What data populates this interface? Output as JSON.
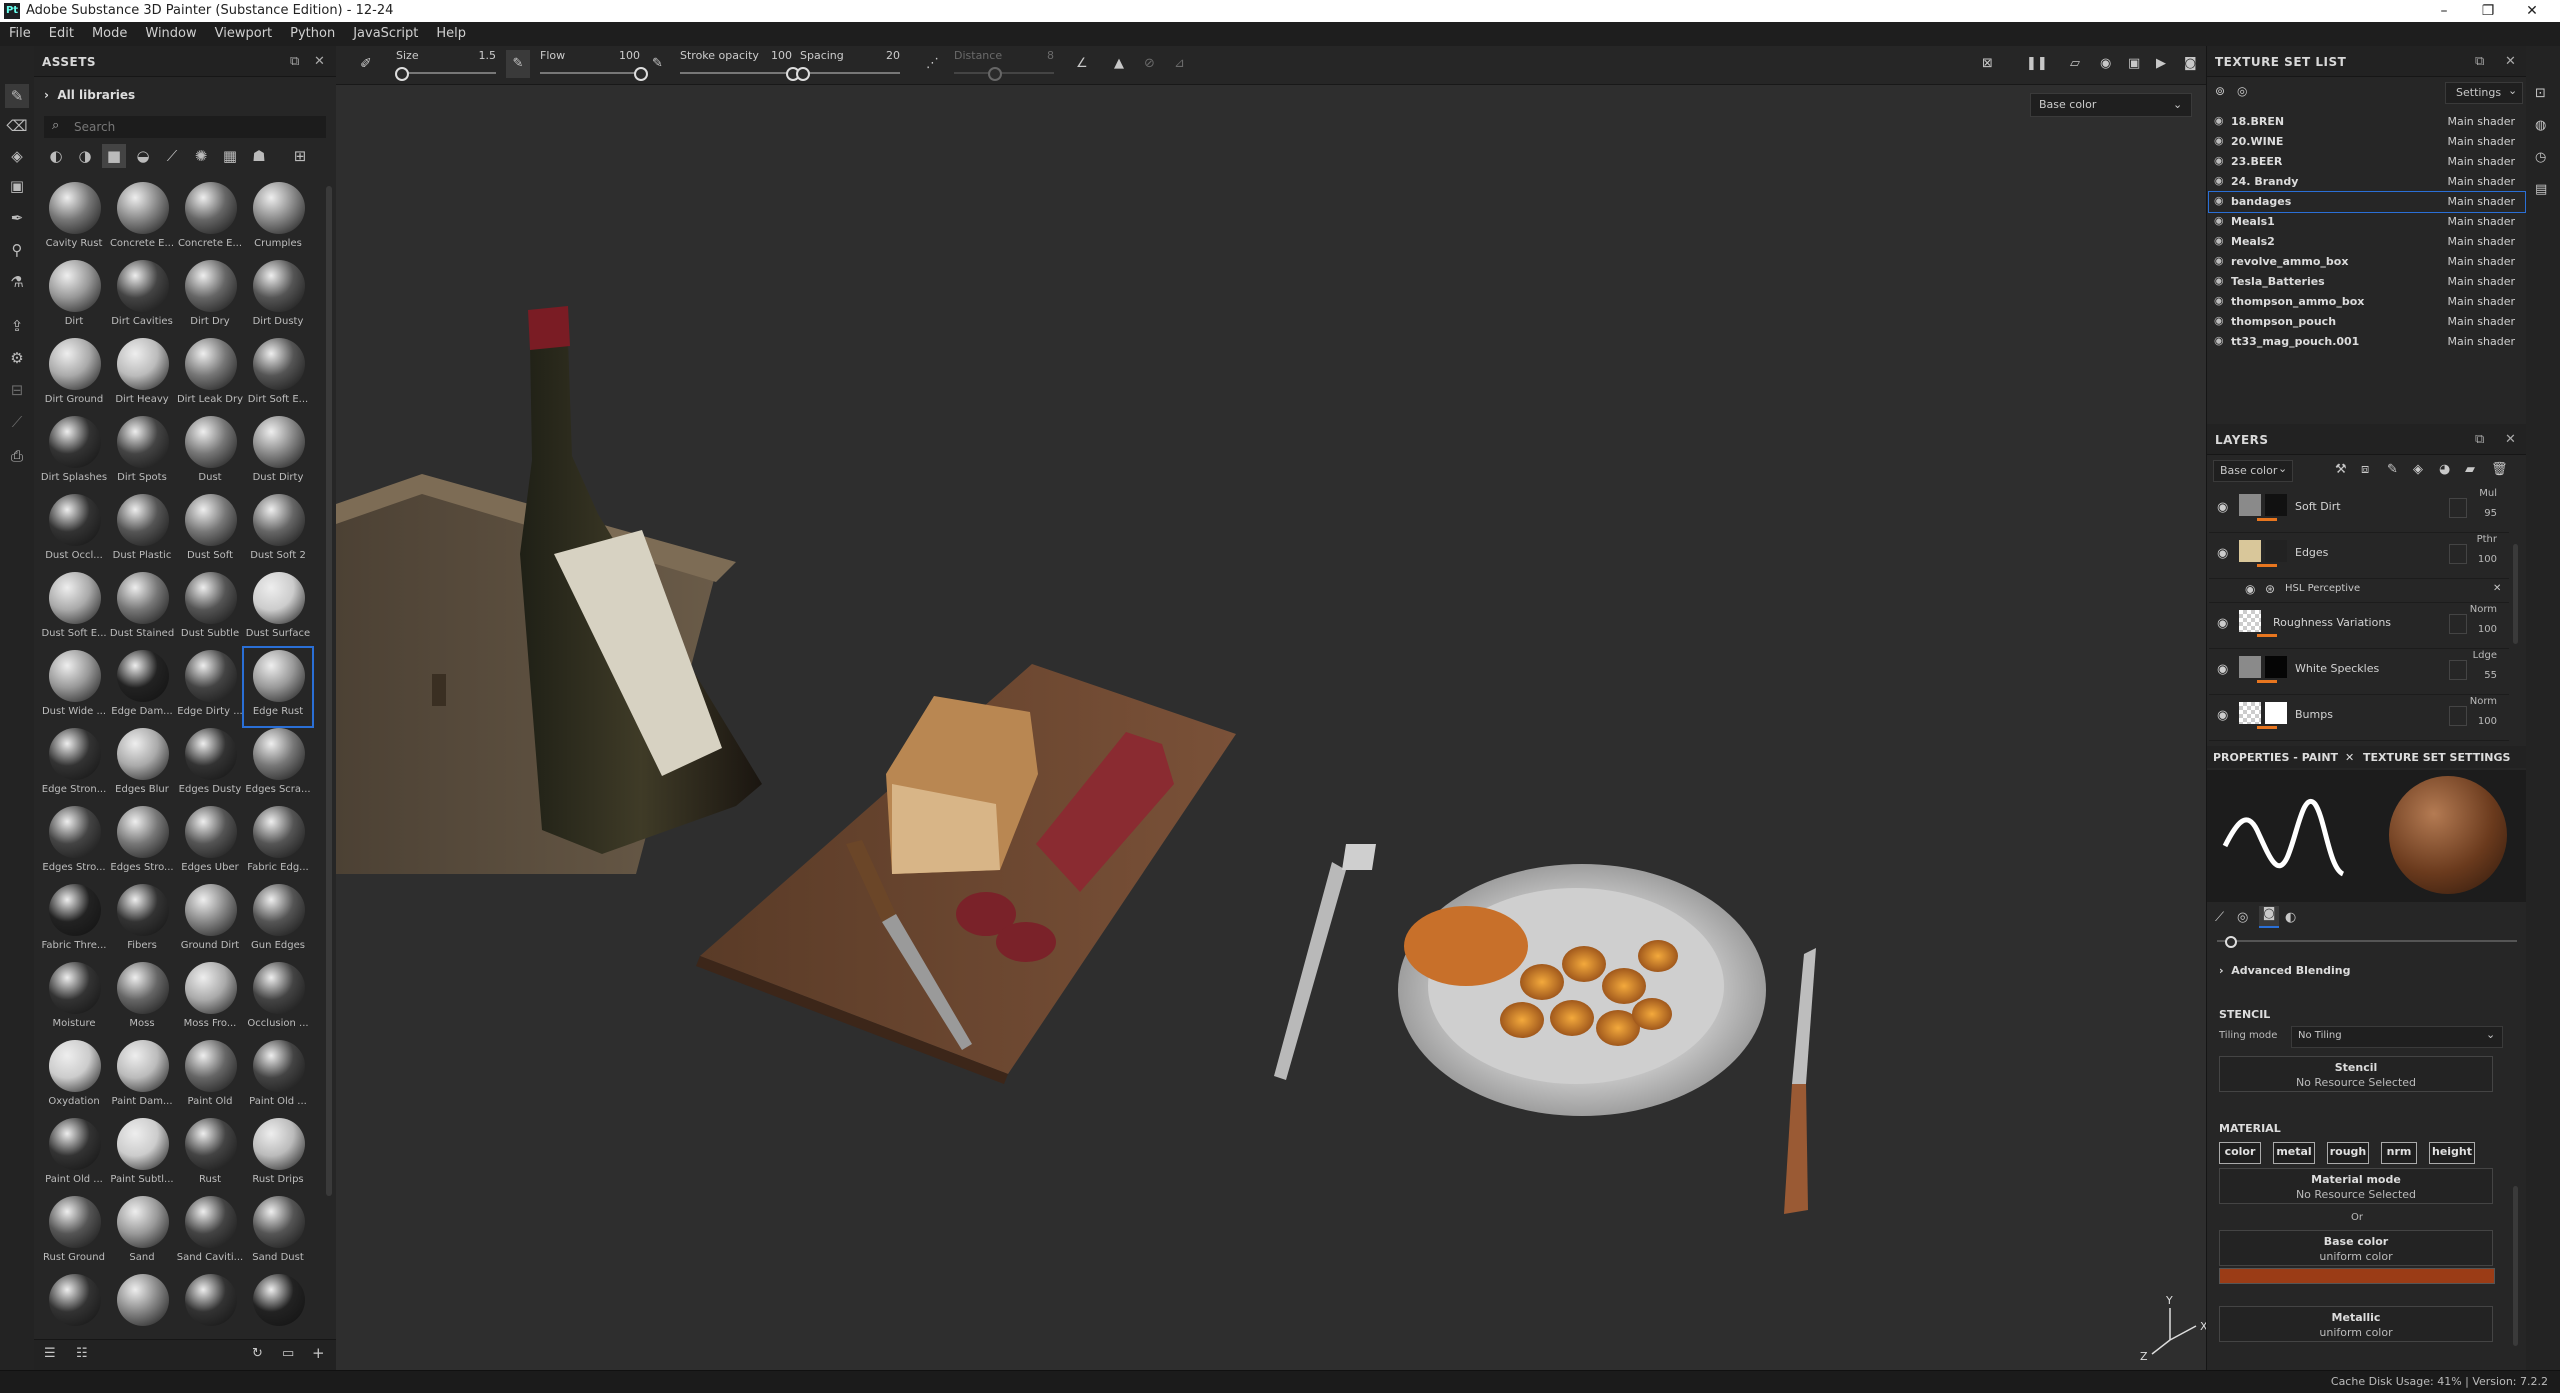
{
  "window": {
    "title": "Adobe Substance 3D Painter (Substance Edition) - 12-24",
    "logo": "Pt",
    "controls": [
      "–",
      "❐",
      "✕"
    ]
  },
  "menu": [
    "File",
    "Edit",
    "Mode",
    "Window",
    "Viewport",
    "Python",
    "JavaScript",
    "Help"
  ],
  "assets": {
    "title": "ASSETS",
    "library": "All libraries",
    "search_placeholder": "Search",
    "items": [
      {
        "label": "Cavity Rust",
        "tone": "#777"
      },
      {
        "label": "Concrete E...",
        "tone": "#888"
      },
      {
        "label": "Concrete E...",
        "tone": "#666"
      },
      {
        "label": "Crumples",
        "tone": "#8a8a8a"
      },
      {
        "label": "Dirt",
        "tone": "#999"
      },
      {
        "label": "Dirt Cavities",
        "tone": "#444"
      },
      {
        "label": "Dirt Dry",
        "tone": "#666"
      },
      {
        "label": "Dirt Dusty",
        "tone": "#555"
      },
      {
        "label": "Dirt Ground",
        "tone": "#aaa"
      },
      {
        "label": "Dirt Heavy",
        "tone": "#bbb"
      },
      {
        "label": "Dirt Leak Dry",
        "tone": "#777"
      },
      {
        "label": "Dirt Soft E...",
        "tone": "#555"
      },
      {
        "label": "Dirt Splashes",
        "tone": "#333"
      },
      {
        "label": "Dirt Spots",
        "tone": "#444"
      },
      {
        "label": "Dust",
        "tone": "#777"
      },
      {
        "label": "Dust Dirty",
        "tone": "#888"
      },
      {
        "label": "Dust Occl...",
        "tone": "#333"
      },
      {
        "label": "Dust Plastic",
        "tone": "#555"
      },
      {
        "label": "Dust Soft",
        "tone": "#777"
      },
      {
        "label": "Dust Soft 2",
        "tone": "#666"
      },
      {
        "label": "Dust Soft E...",
        "tone": "#aaa"
      },
      {
        "label": "Dust Stained",
        "tone": "#777"
      },
      {
        "label": "Dust Subtle",
        "tone": "#555"
      },
      {
        "label": "Dust Surface",
        "tone": "#ccc"
      },
      {
        "label": "Dust Wide ...",
        "tone": "#999"
      },
      {
        "label": "Edge Dam...",
        "tone": "#222"
      },
      {
        "label": "Edge Dirty ...",
        "tone": "#444"
      },
      {
        "label": "Edge Rust",
        "tone": "#999"
      },
      {
        "label": "Edge Stron...",
        "tone": "#333"
      },
      {
        "label": "Edges Blur",
        "tone": "#aaa"
      },
      {
        "label": "Edges Dusty",
        "tone": "#333"
      },
      {
        "label": "Edges Scra...",
        "tone": "#777"
      },
      {
        "label": "Edges Stro...",
        "tone": "#444"
      },
      {
        "label": "Edges Stro...",
        "tone": "#777"
      },
      {
        "label": "Edges Uber",
        "tone": "#555"
      },
      {
        "label": "Fabric Edg...",
        "tone": "#555"
      },
      {
        "label": "Fabric Thre...",
        "tone": "#222"
      },
      {
        "label": "Fibers",
        "tone": "#333"
      },
      {
        "label": "Ground Dirt",
        "tone": "#888"
      },
      {
        "label": "Gun Edges",
        "tone": "#555"
      },
      {
        "label": "Moisture",
        "tone": "#333"
      },
      {
        "label": "Moss",
        "tone": "#666"
      },
      {
        "label": "Moss Fro...",
        "tone": "#aaa"
      },
      {
        "label": "Occlusion ...",
        "tone": "#444"
      },
      {
        "label": "Oxydation",
        "tone": "#ccc"
      },
      {
        "label": "Paint Dam...",
        "tone": "#bbb"
      },
      {
        "label": "Paint Old",
        "tone": "#666"
      },
      {
        "label": "Paint Old ...",
        "tone": "#444"
      },
      {
        "label": "Paint Old ...",
        "tone": "#333"
      },
      {
        "label": "Paint Subtl...",
        "tone": "#ccc"
      },
      {
        "label": "Rust",
        "tone": "#444"
      },
      {
        "label": "Rust Drips",
        "tone": "#bbb"
      },
      {
        "label": "Rust Ground",
        "tone": "#555"
      },
      {
        "label": "Sand",
        "tone": "#999"
      },
      {
        "label": "Sand Caviti...",
        "tone": "#444"
      },
      {
        "label": "Sand Dust",
        "tone": "#555"
      },
      {
        "label": "",
        "tone": "#333"
      },
      {
        "label": "",
        "tone": "#888"
      },
      {
        "label": "",
        "tone": "#333"
      },
      {
        "label": "",
        "tone": "#222"
      }
    ],
    "selected_index": 27
  },
  "context_bar": {
    "size": {
      "name": "Size",
      "value": "1.5",
      "fraction": 0.05
    },
    "flow": {
      "name": "Flow",
      "value": "100",
      "fraction": 1.0
    },
    "stroke_opacity": {
      "name": "Stroke opacity",
      "value": "100",
      "fraction": 1.0
    },
    "spacing": {
      "name": "Spacing",
      "value": "20",
      "fraction": 0.02
    },
    "distance": {
      "name": "Distance",
      "value": "8",
      "fraction": 0.4
    },
    "channel_select": "Base color"
  },
  "texture_sets": {
    "title": "TEXTURE SET LIST",
    "settings_label": "Settings",
    "rows": [
      {
        "name": "18.BREN",
        "shader": "Main shader"
      },
      {
        "name": "20.WINE",
        "shader": "Main shader"
      },
      {
        "name": "23.BEER",
        "shader": "Main shader"
      },
      {
        "name": "24. Brandy",
        "shader": "Main shader"
      },
      {
        "name": "bandages",
        "shader": "Main shader"
      },
      {
        "name": "Meals1",
        "shader": "Main shader"
      },
      {
        "name": "Meals2",
        "shader": "Main shader"
      },
      {
        "name": "revolve_ammo_box",
        "shader": "Main shader"
      },
      {
        "name": "Tesla_Batteries",
        "shader": "Main shader"
      },
      {
        "name": "thompson_ammo_box",
        "shader": "Main shader"
      },
      {
        "name": "thompson_pouch",
        "shader": "Main shader"
      },
      {
        "name": "tt33_mag_pouch.001",
        "shader": "Main shader"
      }
    ],
    "selected_index": 4
  },
  "layers": {
    "title": "LAYERS",
    "channel": "Base color",
    "items": [
      {
        "name": "Soft Dirt",
        "blend": "Mul",
        "opacity": "95"
      },
      {
        "name": "Edges",
        "blend": "Pthr",
        "opacity": "100"
      },
      {
        "name": "Roughness Variations",
        "blend": "Norm",
        "opacity": "100"
      },
      {
        "name": "White Speckles",
        "blend": "Ldge",
        "opacity": "55"
      },
      {
        "name": "Bumps",
        "blend": "Norm",
        "opacity": "100"
      }
    ],
    "filter_name": "HSL Perceptive"
  },
  "properties": {
    "tab1": "PROPERTIES - PAINT",
    "tab2": "TEXTURE SET SETTINGS",
    "advanced_blending": "Advanced Blending",
    "stencil_section": "STENCIL",
    "tiling_label": "Tiling mode",
    "tiling_value": "No Tiling",
    "stencil_title": "Stencil",
    "stencil_sub": "No Resource Selected",
    "material_section": "MATERIAL",
    "channels": [
      "color",
      "metal",
      "rough",
      "nrm",
      "height"
    ],
    "material_mode_title": "Material mode",
    "material_mode_sub": "No Resource Selected",
    "or_label": "Or",
    "base_color_title": "Base color",
    "base_color_sub": "uniform color",
    "base_color_hex": "#9b3c16",
    "metallic_title": "Metallic",
    "metallic_sub": "uniform color"
  },
  "status": {
    "text": "Cache Disk Usage:  41% | Version: 7.2.2"
  },
  "icons": {
    "paint": "brush-icon",
    "eraser": "eraser-icon",
    "projection": "projection-icon",
    "eye": "eye-icon",
    "close": "close-icon"
  }
}
